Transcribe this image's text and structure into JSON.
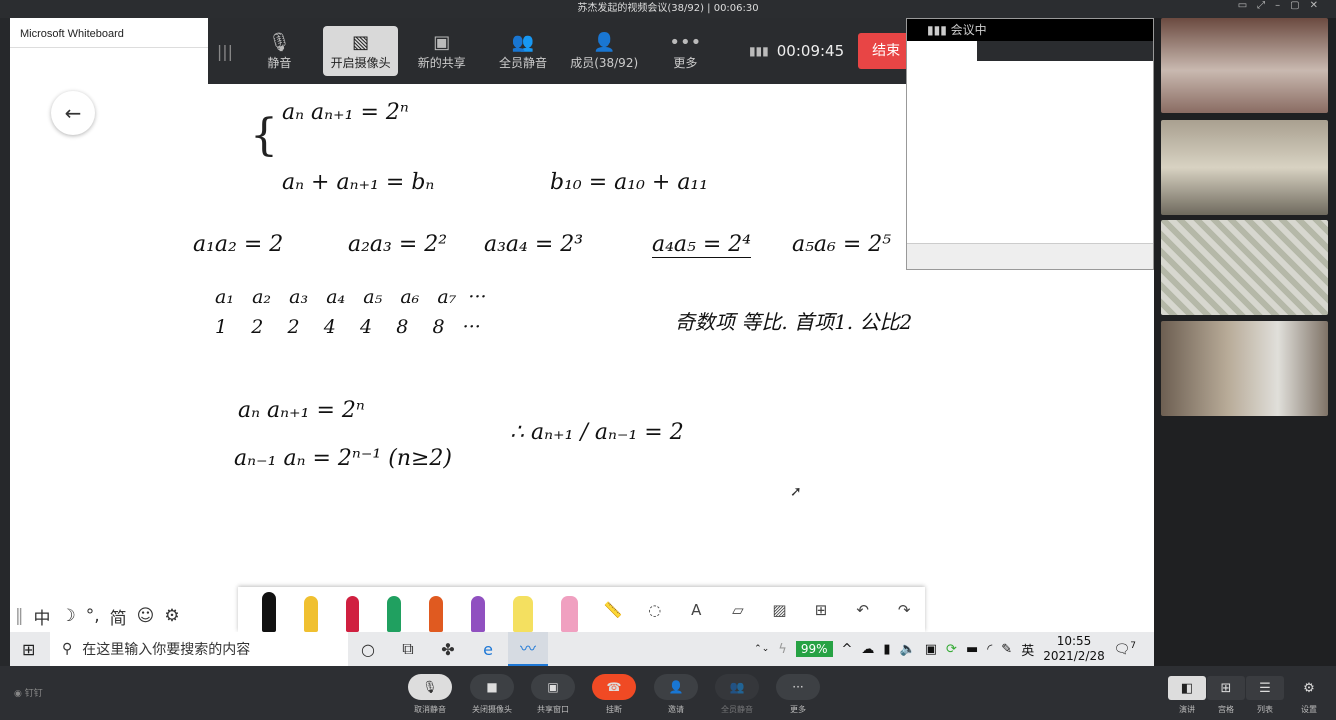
{
  "window": {
    "title": "苏杰发起的视频会议(38/92) | 00:06:30"
  },
  "whiteboard": {
    "app_title": "Microsoft Whiteboard",
    "lines": [
      {
        "text": "aₙ aₙ₊₁ = 2ⁿ"
      },
      {
        "text": "aₙ + aₙ₊₁ = bₙ"
      },
      {
        "text": "b₁₀ = a₁₀ + a₁₁"
      },
      {
        "text": "a₁a₂ = 2"
      },
      {
        "text": "a₂a₃ = 2²"
      },
      {
        "text": "a₃a₄ = 2³"
      },
      {
        "text": "a₄a₅ = 2⁴"
      },
      {
        "text": "a₅a₆ = 2⁵"
      },
      {
        "text": "a₁   a₂   a₃   a₄   a₅   a₆   a₇  ···"
      },
      {
        "text": "1    2    2    4    4    8    8   ···"
      },
      {
        "text": "奇数项 等比.  首项1.  公比2"
      },
      {
        "text": "aₙ aₙ₊₁ = 2ⁿ"
      },
      {
        "text": "aₙ₋₁ aₙ = 2ⁿ⁻¹   (n≥2)"
      },
      {
        "text": "∴  aₙ₊₁ / aₙ₋₁ = 2"
      }
    ]
  },
  "meeting_toolbar": {
    "buttons": [
      {
        "label": "静音",
        "icon": "microphone-icon"
      },
      {
        "label": "开启摄像头",
        "icon": "camera-off-icon",
        "active": true
      },
      {
        "label": "新的共享",
        "icon": "share-icon"
      },
      {
        "label": "全员静音",
        "icon": "mute-all-icon"
      },
      {
        "label": "成员(38/92)",
        "icon": "add-member-icon"
      },
      {
        "label": "更多",
        "icon": "more-icon"
      }
    ],
    "timer": "00:09:45",
    "end_label": "结束会议"
  },
  "preview": {
    "header": "会议中"
  },
  "taskbar": {
    "search_placeholder": "在这里输入你要搜索的内容",
    "battery": "99%",
    "ime": "英",
    "time": "10:55",
    "date": "2021/2/28",
    "notifications": "7"
  },
  "ime_bar": {
    "items": [
      "中",
      "☽",
      "°,",
      "简",
      "☺",
      "⚙"
    ]
  },
  "bottom_bar": {
    "brand": "钉钉",
    "buttons": [
      {
        "label": "取消静音"
      },
      {
        "label": "关闭摄像头"
      },
      {
        "label": "共享窗口"
      },
      {
        "label": "挂断",
        "color": "#f04a24"
      },
      {
        "label": "邀请"
      },
      {
        "label": "全员静音"
      },
      {
        "label": "更多"
      }
    ],
    "view_buttons": [
      {
        "label": "演讲"
      },
      {
        "label": "宫格"
      },
      {
        "label": "列表"
      },
      {
        "label": "设置"
      }
    ]
  }
}
